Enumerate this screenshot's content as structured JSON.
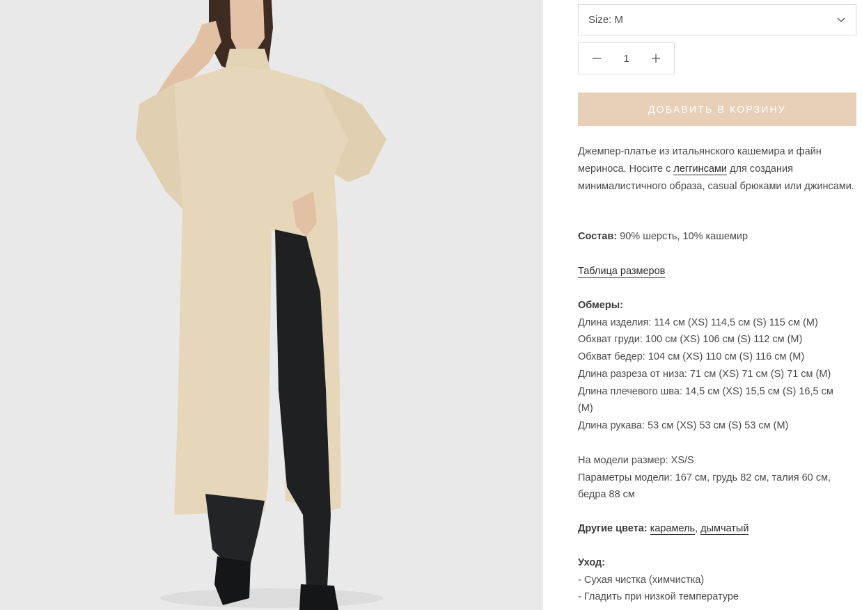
{
  "product": {
    "size_select": "Size: M",
    "quantity": "1",
    "add_to_cart": "ДОБАВИТЬ В КОРЗИНУ"
  },
  "description": {
    "part1": "Джемпер-платье из итальянского кашемира и файн мериноса. Носите с ",
    "link_leggings": "леггинсами",
    "part2": " для создания минималистичного образа, casual брюками или джинсами."
  },
  "composition": {
    "label": "Состав:",
    "value": " 90% шерсть, 10% кашемир"
  },
  "size_chart_link": "Таблица размеров",
  "measurements": {
    "label": "Обмеры:",
    "lines": [
      "Длина изделия: 114 см (XS) 114,5 см (S) 115 см (M)",
      "Обхват груди: 100 см (XS) 106 см (S) 112 см (M)",
      "Обхват бедер: 104 см (XS) 110 см (S) 116 см (M)",
      "Длина разреза от низа: 71 см (XS) 71 см (S) 71 см (M)",
      "Длина плечевого шва: 14,5 см (XS) 15,5 см (S) 16,5 см",
      "(M)",
      "Длина рукава: 53 см (XS) 53 см (S) 53 см (M)"
    ]
  },
  "model": {
    "size": "На модели размер: XS/S",
    "params_line1": "Параметры модели: 167 см, грудь 82 см, талия 60 см,",
    "params_line2": "бедра 88 см"
  },
  "other_colors": {
    "label": "Другие цвета:",
    "colors": [
      "карамель",
      "дымчатый"
    ],
    "separator": ", "
  },
  "care": {
    "label": "Уход:",
    "items": [
      "- Сухая чистка (химчистка)",
      "- Гладить при низкой температуре"
    ]
  },
  "colors": {
    "button_bg": "#e8d0b8",
    "sweater": "#e6d7bb",
    "pants": "#1f2022"
  }
}
